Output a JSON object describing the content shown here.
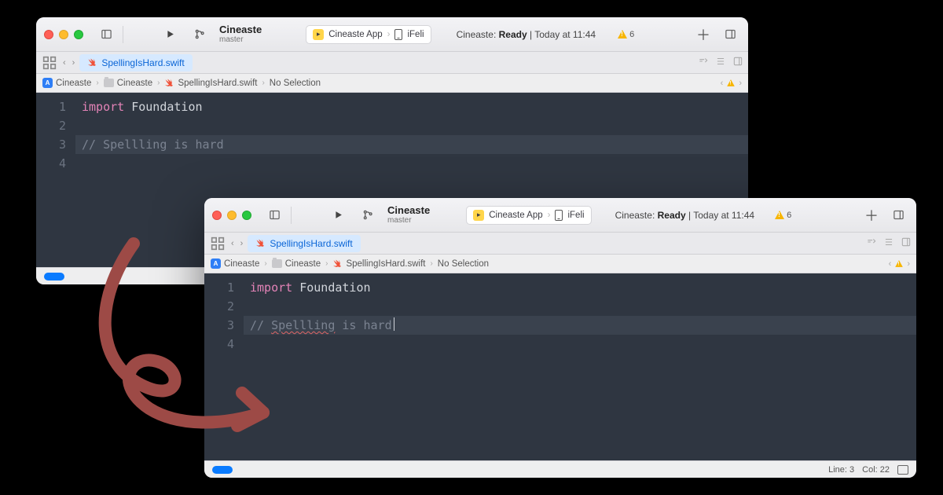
{
  "scheme": {
    "name": "Cineaste",
    "branch": "master"
  },
  "run_target": {
    "app": "Cineaste App",
    "device": "iFeli"
  },
  "status": {
    "project": "Cineaste",
    "state": "Ready",
    "time": "Today at 11:44"
  },
  "warnings": {
    "count": "6"
  },
  "tab": {
    "filename": "SpellingIsHard.swift"
  },
  "breadcrumb": {
    "project": "Cineaste",
    "group": "Cineaste",
    "file": "SpellingIsHard.swift",
    "selection": "No Selection"
  },
  "code": {
    "line1_keyword": "import",
    "line1_module": "Foundation",
    "line3_prefix": "// ",
    "line3_bad": "Spellling",
    "line3_rest": " is hard"
  },
  "lines": {
    "l1": "1",
    "l2": "2",
    "l3": "3",
    "l4": "4"
  },
  "footer": {
    "line": "Line: 3",
    "col": "Col: 22"
  }
}
